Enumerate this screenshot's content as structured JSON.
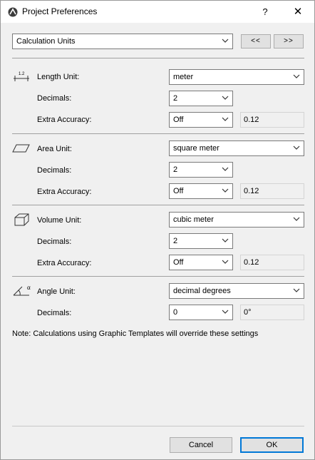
{
  "window": {
    "title": "Project Preferences",
    "help": "?",
    "close": "✕"
  },
  "top": {
    "category": "Calculation Units",
    "prev_label": "<<",
    "next_label": ">>"
  },
  "length": {
    "unit_label": "Length Unit:",
    "unit_value": "meter",
    "decimals_label": "Decimals:",
    "decimals_value": "2",
    "accuracy_label": "Extra Accuracy:",
    "accuracy_value": "Off",
    "sample": "0.12",
    "icon_text": "1.2"
  },
  "area": {
    "unit_label": "Area Unit:",
    "unit_value": "square meter",
    "decimals_label": "Decimals:",
    "decimals_value": "2",
    "accuracy_label": "Extra Accuracy:",
    "accuracy_value": "Off",
    "sample": "0.12"
  },
  "volume": {
    "unit_label": "Volume Unit:",
    "unit_value": "cubic meter",
    "decimals_label": "Decimals:",
    "decimals_value": "2",
    "accuracy_label": "Extra Accuracy:",
    "accuracy_value": "Off",
    "sample": "0.12"
  },
  "angle": {
    "unit_label": "Angle Unit:",
    "unit_value": "decimal degrees",
    "decimals_label": "Decimals:",
    "decimals_value": "0",
    "sample": "0°",
    "icon_text": "α"
  },
  "note": "Note: Calculations using Graphic Templates will override these settings",
  "buttons": {
    "cancel": "Cancel",
    "ok": "OK"
  },
  "icons": {
    "app": "archicad-icon",
    "dropdown": "chevron-down-icon"
  },
  "colors": {
    "default_button_border": "#0078d7",
    "field_border": "#7a7a7a",
    "background": "#f0f0f0"
  }
}
